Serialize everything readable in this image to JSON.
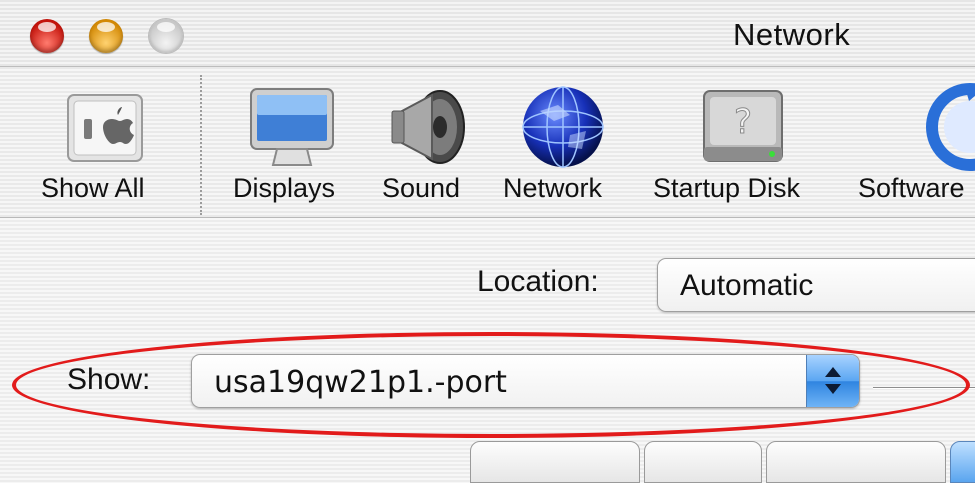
{
  "window": {
    "title": "Network",
    "controls": [
      "close-button",
      "minimize-button",
      "zoom-button"
    ]
  },
  "toolbar": {
    "items": [
      {
        "label": "Show All",
        "icon": "show-all-icon"
      },
      {
        "label": "Displays",
        "icon": "display-icon"
      },
      {
        "label": "Sound",
        "icon": "speaker-icon"
      },
      {
        "label": "Network",
        "icon": "globe-icon"
      },
      {
        "label": "Startup Disk",
        "icon": "hard-disk-icon"
      },
      {
        "label": "Software",
        "icon": "software-update-icon"
      }
    ]
  },
  "location": {
    "label": "Location:",
    "value": "Automatic"
  },
  "show": {
    "label": "Show:",
    "value": "usa19qw21p1.-port"
  },
  "colors": {
    "highlight": "#e21b1b",
    "accent": "#2f84e0"
  }
}
